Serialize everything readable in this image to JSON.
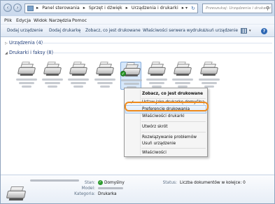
{
  "address": {
    "crumbs": [
      "Panel sterowania",
      "Sprzęt i dźwięk",
      "Urządzenia i drukarki"
    ],
    "separator": "▸",
    "search_placeholder": "Przeszukaj: Urządzenia i drukarki"
  },
  "menu": [
    "Plik",
    "Edycja",
    "Widok",
    "Narzędzia",
    "Pomoc"
  ],
  "commands": [
    "Dodaj urządzenie",
    "Dodaj drukarkę",
    "Zobacz, co jest drukowane",
    "Właściwości serwera wydruku",
    "Usuń urządzenie"
  ],
  "groups": {
    "devices": "Urządzenia (4)",
    "printers": "Drukarki i faksy (8)"
  },
  "printers_count": 8,
  "selected_printer_index": 4,
  "context_menu": {
    "items": [
      {
        "label": "Zobacz, co jest drukowane",
        "bold": true
      },
      {
        "label": "Ustaw jako drukarkę domyślną",
        "checked": true
      },
      {
        "label": "Preferencje drukowania",
        "highlighted": true
      },
      {
        "label": "Właściwości drukarki"
      },
      {
        "label": "Utwórz skrót"
      },
      {
        "label": "Rozwiązywanie problemów"
      },
      {
        "label": "Usuń urządzenie"
      },
      {
        "label": "Właściwości"
      }
    ]
  },
  "details": {
    "state_label": "Stan:",
    "state_value": "Domyślny",
    "model_label": "Model:",
    "category_label": "Kategoria:",
    "category_value": "Drukarka",
    "status_label": "Status:",
    "status_value": "Liczba dokumentów w kolejce: 0"
  },
  "colors": {
    "highlight_ring": "#ee8a1c",
    "selection": "#d7e8fb",
    "default_check": "#2a9a2a"
  },
  "icons": [
    "back-arrow-icon",
    "forward-arrow-icon",
    "control-panel-icon",
    "refresh-icon",
    "search-icon",
    "view-options-icon",
    "help-icon",
    "printer-icon",
    "check-icon"
  ]
}
